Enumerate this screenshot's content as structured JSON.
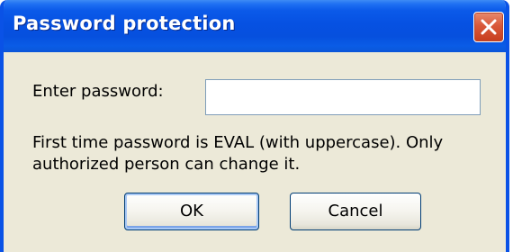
{
  "window": {
    "title": "Password protection",
    "close_label": "Close"
  },
  "form": {
    "password_label": "Enter password:",
    "password_value": "",
    "message": "First time password is EVAL (with uppercase). Only authorized person can change it."
  },
  "buttons": {
    "ok_label": "OK",
    "cancel_label": "Cancel"
  },
  "colors": {
    "titlebar": "#0651e2",
    "dialog_background": "#ece9d8",
    "close_button": "#d9593a"
  },
  "icons": {
    "close": "close-icon"
  }
}
